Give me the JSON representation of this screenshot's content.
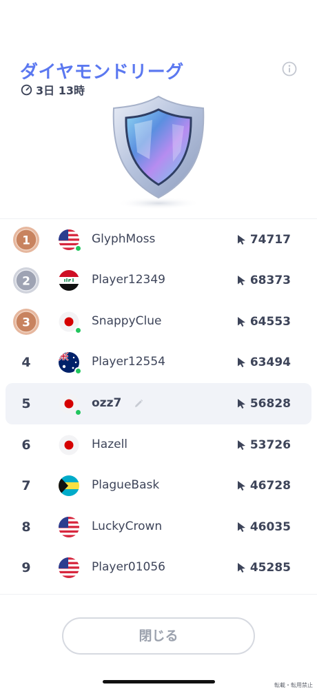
{
  "header": {
    "title": "ダイヤモンドリーグ",
    "timer_text": "3日 13時",
    "title_color": "#5b78f0"
  },
  "icons": {
    "timer": "clock-icon",
    "info": "info-icon",
    "league_badge": "diamond-shield-icon",
    "score": "cursor-icon",
    "edit": "pencil-icon"
  },
  "leaderboard": [
    {
      "rank": "1",
      "name": "GlyphMoss",
      "score": "74717",
      "flag": "us",
      "medal": "bronze",
      "online": true
    },
    {
      "rank": "2",
      "name": "Player12349",
      "score": "68373",
      "flag": "iq",
      "medal": "silver",
      "online": false
    },
    {
      "rank": "3",
      "name": "SnappyClue",
      "score": "64553",
      "flag": "jp",
      "medal": "bronze",
      "online": true
    },
    {
      "rank": "4",
      "name": "Player12554",
      "score": "63494",
      "flag": "au",
      "medal": "",
      "online": true
    },
    {
      "rank": "5",
      "name": "ozz7",
      "score": "56828",
      "flag": "jp",
      "medal": "",
      "online": true,
      "is_current_user": true
    },
    {
      "rank": "6",
      "name": "Hazell",
      "score": "53726",
      "flag": "jp",
      "medal": "",
      "online": false
    },
    {
      "rank": "7",
      "name": "PlagueBask",
      "score": "46728",
      "flag": "bs",
      "medal": "",
      "online": false
    },
    {
      "rank": "8",
      "name": "LuckyCrown",
      "score": "46035",
      "flag": "us",
      "medal": "",
      "online": false
    },
    {
      "rank": "9",
      "name": "Player01056",
      "score": "45285",
      "flag": "us",
      "medal": "",
      "online": false
    }
  ],
  "actions": {
    "close_label": "閉じる"
  },
  "footer": {
    "note": "転載・転用禁止"
  },
  "colors": {
    "accent": "#5b78f0",
    "text": "#3d4459",
    "online": "#22c55e",
    "medal_bronze": "#c8835f",
    "medal_silver": "#9ea3b3",
    "current_row_bg": "#f1f3f8"
  }
}
